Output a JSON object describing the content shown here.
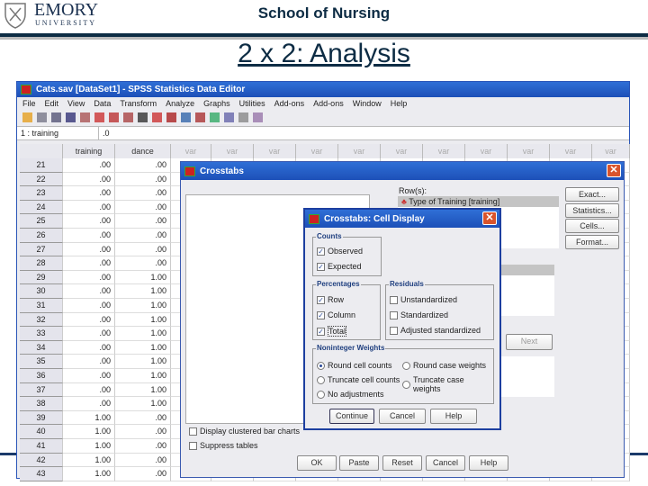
{
  "slide": {
    "logo_name": "EMORY",
    "logo_sub": "UNIVERSITY",
    "header": "School of Nursing",
    "title": "2 x 2: Analysis",
    "accent": "#0d2c44"
  },
  "editor": {
    "title": "Cats.sav [DataSet1] - SPSS Statistics Data Editor",
    "menu": [
      "File",
      "Edit",
      "View",
      "Data",
      "Transform",
      "Analyze",
      "Graphs",
      "Utilities",
      "Add-ons",
      "Add-ons",
      "Window",
      "Help"
    ],
    "cell_ref": "1 : training",
    "cell_value": ".0",
    "columns": [
      "training",
      "dance",
      "var",
      "var",
      "var",
      "var",
      "var",
      "var",
      "var",
      "var",
      "var",
      "var",
      "var"
    ],
    "rows": [
      {
        "n": "21",
        "training": ".00",
        "dance": ".00"
      },
      {
        "n": "22",
        "training": ".00",
        "dance": ".00"
      },
      {
        "n": "23",
        "training": ".00",
        "dance": ".00"
      },
      {
        "n": "24",
        "training": ".00",
        "dance": ".00"
      },
      {
        "n": "25",
        "training": ".00",
        "dance": ".00"
      },
      {
        "n": "26",
        "training": ".00",
        "dance": ".00"
      },
      {
        "n": "27",
        "training": ".00",
        "dance": ".00"
      },
      {
        "n": "28",
        "training": ".00",
        "dance": ".00"
      },
      {
        "n": "29",
        "training": ".00",
        "dance": "1.00"
      },
      {
        "n": "30",
        "training": ".00",
        "dance": "1.00"
      },
      {
        "n": "31",
        "training": ".00",
        "dance": "1.00"
      },
      {
        "n": "32",
        "training": ".00",
        "dance": "1.00"
      },
      {
        "n": "33",
        "training": ".00",
        "dance": "1.00"
      },
      {
        "n": "34",
        "training": ".00",
        "dance": "1.00"
      },
      {
        "n": "35",
        "training": ".00",
        "dance": "1.00"
      },
      {
        "n": "36",
        "training": ".00",
        "dance": "1.00"
      },
      {
        "n": "37",
        "training": ".00",
        "dance": "1.00"
      },
      {
        "n": "38",
        "training": ".00",
        "dance": "1.00"
      },
      {
        "n": "39",
        "training": "1.00",
        "dance": ".00"
      },
      {
        "n": "40",
        "training": "1.00",
        "dance": ".00"
      },
      {
        "n": "41",
        "training": "1.00",
        "dance": ".00"
      },
      {
        "n": "42",
        "training": "1.00",
        "dance": ".00"
      },
      {
        "n": "43",
        "training": "1.00",
        "dance": ".00"
      }
    ]
  },
  "crosstabs": {
    "title": "Crosstabs",
    "rows_label": "Row(s):",
    "row_item": "Type of Training [training]",
    "side_buttons": [
      "Exact...",
      "Statistics...",
      "Cells...",
      "Format..."
    ],
    "next_button": "Next",
    "display_clustered": "Display clustered bar charts",
    "suppress_tables": "Suppress tables",
    "bottom_buttons": [
      "OK",
      "Paste",
      "Reset",
      "Cancel",
      "Help"
    ]
  },
  "cell_display": {
    "title": "Crosstabs: Cell Display",
    "counts": {
      "label": "Counts",
      "observed": "Observed",
      "expected": "Expected",
      "observed_checked": true,
      "expected_checked": true
    },
    "percentages": {
      "label": "Percentages",
      "row": "Row",
      "column": "Column",
      "total": "Total"
    },
    "residuals": {
      "label": "Residuals",
      "unstandardized": "Unstandardized",
      "standardized": "Standardized",
      "adjusted": "Adjusted standardized"
    },
    "weights": {
      "label": "Noninteger Weights",
      "round_cell": "Round cell counts",
      "round_case": "Round case weights",
      "truncate_cell": "Truncate cell counts",
      "truncate_case": "Truncate case weights",
      "no_adj": "No adjustments",
      "selected": "Round cell counts"
    },
    "buttons": {
      "continue": "Continue",
      "cancel": "Cancel",
      "help": "Help"
    }
  }
}
